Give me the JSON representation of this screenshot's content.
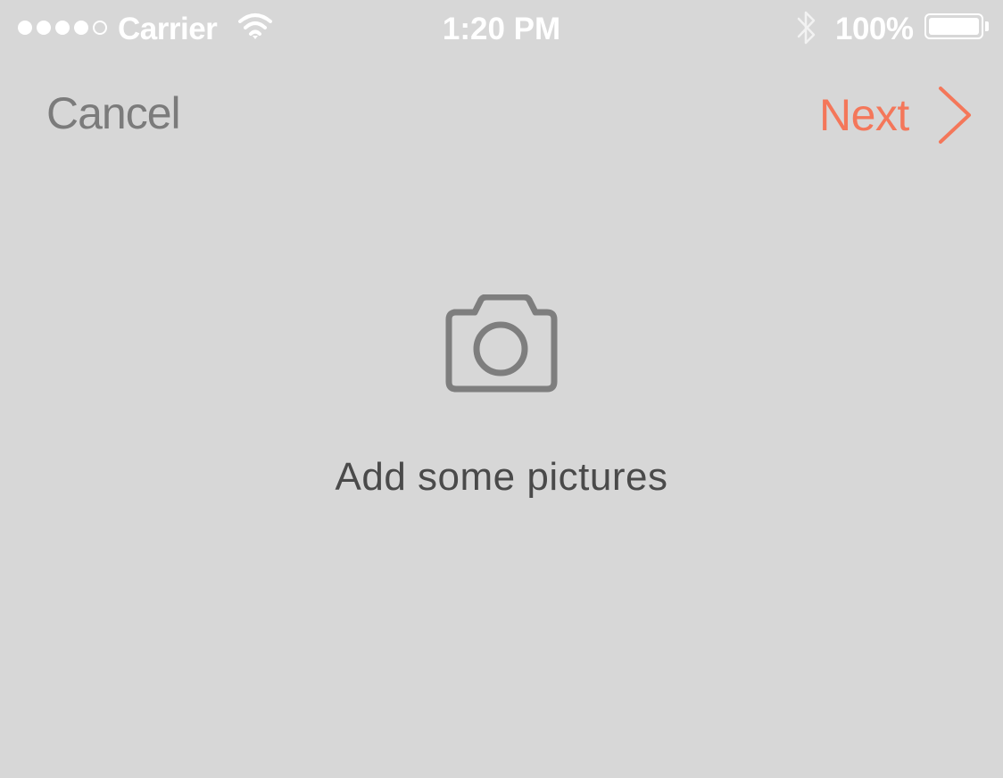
{
  "status_bar": {
    "signal_bars_filled": 4,
    "signal_bars_total": 5,
    "carrier": "Carrier",
    "time": "1:20 PM",
    "battery_percent": "100%",
    "battery_level": 1.0,
    "icons": [
      "wifi-icon",
      "bluetooth-icon",
      "battery-icon"
    ]
  },
  "nav": {
    "cancel_label": "Cancel",
    "next_label": "Next",
    "next_icon": "chevron-right-icon"
  },
  "empty_state": {
    "icon": "camera-icon",
    "message": "Add some pictures"
  },
  "colors": {
    "background": "#d7d7d7",
    "accent": "#f4775a",
    "cancel_text": "#7b7b7b",
    "icon_gray": "#7e7e7e",
    "message_text": "#4a4a4a",
    "status_text": "#ffffff"
  }
}
